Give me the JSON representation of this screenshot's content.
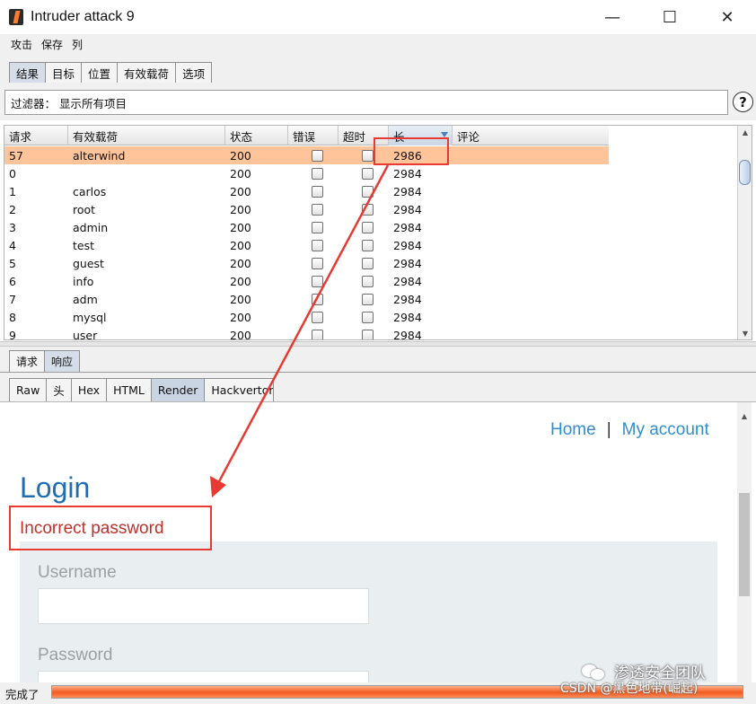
{
  "window": {
    "title": "Intruder attack 9",
    "controls": {
      "minimize": "—",
      "maximize": "☐",
      "close": "✕"
    }
  },
  "menu": [
    "攻击",
    "保存",
    "列"
  ],
  "main_tabs": [
    "结果",
    "目标",
    "位置",
    "有效载荷",
    "选项"
  ],
  "filter": {
    "label": "过滤器： 显示所有项目",
    "help": "?"
  },
  "table": {
    "columns": [
      "请求",
      "有效载荷",
      "状态",
      "错误",
      "超时",
      "长",
      "评论"
    ],
    "rows": [
      {
        "req": "57",
        "payload": "alterwind",
        "status": "200",
        "length": "2986",
        "highlighted": true
      },
      {
        "req": "0",
        "payload": "",
        "status": "200",
        "length": "2984"
      },
      {
        "req": "1",
        "payload": "carlos",
        "status": "200",
        "length": "2984"
      },
      {
        "req": "2",
        "payload": "root",
        "status": "200",
        "length": "2984"
      },
      {
        "req": "3",
        "payload": "admin",
        "status": "200",
        "length": "2984"
      },
      {
        "req": "4",
        "payload": "test",
        "status": "200",
        "length": "2984"
      },
      {
        "req": "5",
        "payload": "guest",
        "status": "200",
        "length": "2984"
      },
      {
        "req": "6",
        "payload": "info",
        "status": "200",
        "length": "2984"
      },
      {
        "req": "7",
        "payload": "adm",
        "status": "200",
        "length": "2984"
      },
      {
        "req": "8",
        "payload": "mysql",
        "status": "200",
        "length": "2984"
      },
      {
        "req": "9",
        "payload": "user",
        "status": "200",
        "length": "2984"
      }
    ]
  },
  "detail_tabs": [
    "请求",
    "响应"
  ],
  "view_tabs": [
    "Raw",
    "头",
    "Hex",
    "HTML",
    "Render",
    "Hackvertor"
  ],
  "render": {
    "nav_home": "Home",
    "nav_sep": "|",
    "nav_account": "My account",
    "heading": "Login",
    "error": "Incorrect password",
    "username_label": "Username",
    "password_label": "Password"
  },
  "status": {
    "text": "完成了",
    "progress": 1.0
  },
  "colors": {
    "highlight_row": "#ffc49a",
    "annotation": "#e83a32",
    "link": "#2e8fd0",
    "heading": "#1e6eb5",
    "error": "#c0302a"
  },
  "watermark": {
    "text": "渗透安全团队",
    "csdn": "CSDN @黑色地带(崛起)"
  }
}
